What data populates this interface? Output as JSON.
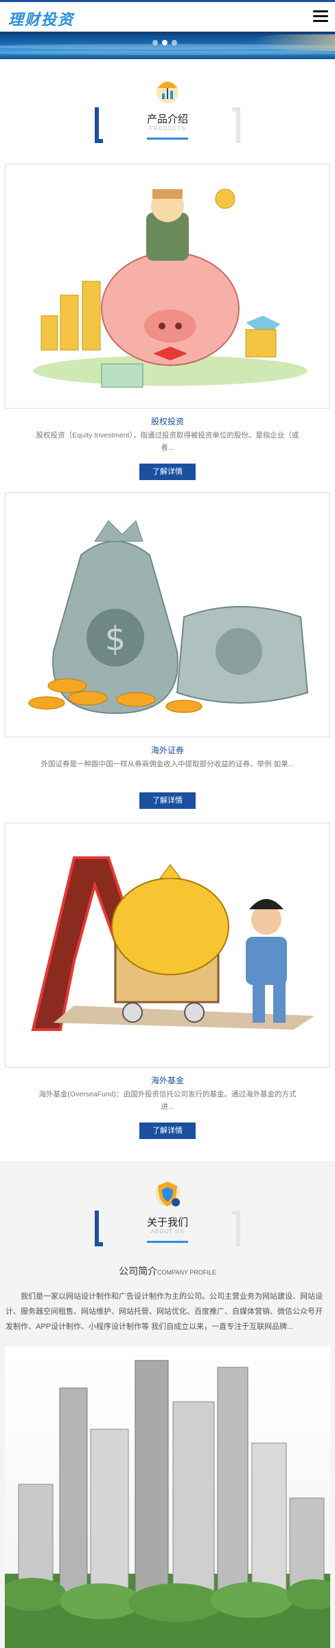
{
  "header": {
    "logo_text": "理财投资",
    "menu_icon": "hamburger-menu-icon"
  },
  "banner": {
    "slide_count": 3,
    "active_slide": 2
  },
  "products_section": {
    "title": "产品介绍",
    "subtitle": "PRODUCTS"
  },
  "products": [
    {
      "title": "股权投资",
      "desc": "股权投资（Equity Investment），指通过投资取得被投资单位的股份。是指企业（或者...",
      "button": "了解详情"
    },
    {
      "title": "海外证券",
      "desc": "外国证券是一种跟中国一样从券商佣金收入中提取部分收益的证券。举例 如果...",
      "button": "了解详情"
    },
    {
      "title": "海外基金",
      "desc": "海外基金(OverseaFund)：由国外投资信托公司发行的基金。通过海外基金的方式进...",
      "button": "了解详情"
    }
  ],
  "about_section": {
    "title": "关于我们",
    "subtitle": "ABOUT US"
  },
  "about": {
    "profile_title": "公司简介",
    "profile_subtitle": "COMPANY PROFILE",
    "text": "我们是一家以网站设计制作和广告设计制作为主的公司。公司主营业务为网站建设、网站设计、服务器空间租售、网站维护、网站托管、网站优化、百度推广、自媒体营销、微信公众号开发制作、APP设计制作、小程序设计制作等 我们自成立以来，一直专注于互联网品牌..."
  },
  "colors": {
    "brand_blue": "#1b4fa0",
    "accent_blue": "#2a8de0"
  }
}
